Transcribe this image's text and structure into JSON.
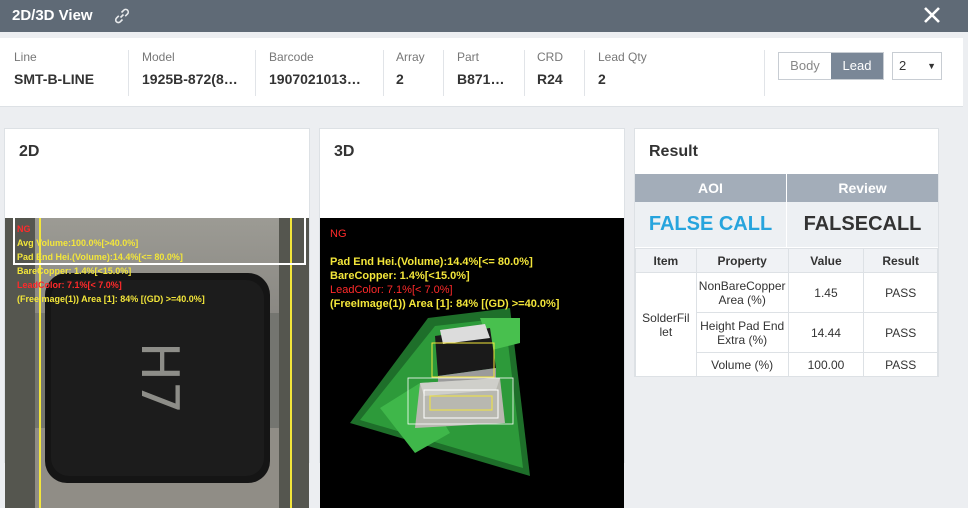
{
  "window": {
    "title": "2D/3D View"
  },
  "info": [
    {
      "label": "Line",
      "value": "SMT-B-LINE"
    },
    {
      "label": "Model",
      "value": "1925B-872(8…"
    },
    {
      "label": "Barcode",
      "value": "1907021013…"
    },
    {
      "label": "Array",
      "value": "2"
    },
    {
      "label": "Part",
      "value": "B871…"
    },
    {
      "label": "CRD",
      "value": "R24"
    },
    {
      "label": "Lead Qty",
      "value": "2"
    }
  ],
  "view_toggle": {
    "body": "Body",
    "lead": "Lead",
    "selected": "Lead"
  },
  "lead_select": {
    "value": "2"
  },
  "panel2d": {
    "title": "2D",
    "overlay": [
      {
        "text": "NG",
        "color": "#ff2a2a"
      },
      {
        "text": "Avg Volume:100.0%[>40.0%]",
        "color": "#f3e63a"
      },
      {
        "text": "Pad End Hei.(Volume):14.4%[<= 80.0%]",
        "color": "#f3e63a"
      },
      {
        "text": "BareCopper: 1.4%[<15.0%]",
        "color": "#f3e63a"
      },
      {
        "text": "LeadColor: 7.1%[< 7.0%]",
        "color": "#ff2a2a"
      },
      {
        "text": "(FreeImage(1)) Area [1]:  84% [(GD) >=40.0%]",
        "color": "#f3e63a"
      }
    ]
  },
  "panel3d": {
    "title": "3D",
    "overlay": [
      {
        "text": "NG",
        "color": "#ff2a2a"
      },
      {
        "text": "Pad End Hei.(Volume):14.4%[<= 80.0%]",
        "color": "#f3e63a"
      },
      {
        "text": "BareCopper: 1.4%[<15.0%]",
        "color": "#f3e63a"
      },
      {
        "text": "LeadColor: 7.1%[< 7.0%]",
        "color": "#ff2a2a"
      },
      {
        "text": "(FreeImage(1)) Area [1]: 84% [(GD) >=40.0%]",
        "color": "#f3e63a"
      }
    ]
  },
  "result": {
    "title": "Result",
    "aoi_label": "AOI",
    "review_label": "Review",
    "aoi_value": "FALSE CALL",
    "review_value": "FALSECALL",
    "columns": [
      "Item",
      "Property",
      "Value",
      "Result"
    ],
    "item": "SolderFillet",
    "rows": [
      {
        "property": "NonBareCopper Area (%)",
        "value": "1.45",
        "result": "PASS"
      },
      {
        "property": "Height Pad End Extra (%)",
        "value": "14.44",
        "result": "PASS"
      },
      {
        "property": "Volume (%)",
        "value": "100.00",
        "result": "PASS"
      }
    ]
  },
  "colors": {
    "titlebar": "#5f6a76",
    "aoi_value": "#27a4dd",
    "toggle_active": "#7a8797",
    "result_header": "#a3adb9"
  },
  "icons": [
    "link-icon",
    "close-icon",
    "chevron-down-icon"
  ]
}
